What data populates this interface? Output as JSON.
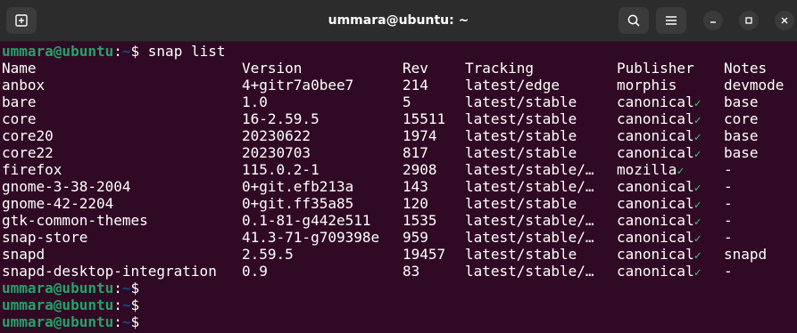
{
  "window": {
    "title": "ummara@ubuntu: ~"
  },
  "icons": {
    "new_tab": "new-tab-icon",
    "search": "search-icon",
    "menu": "hamburger-menu-icon",
    "minimize": "minimize-icon",
    "maximize": "maximize-icon",
    "close": "close-icon",
    "verified": "checkmark-icon"
  },
  "colors": {
    "background": "#300a24",
    "titlebar": "#2c2c2c",
    "prompt_user": "#26a269",
    "prompt_path": "#12488b",
    "check": "#33d17a"
  },
  "prompt": {
    "user_host": "ummara@ubuntu",
    "sep": ":",
    "path": "~",
    "symbol": "$"
  },
  "command": " snap list",
  "table": {
    "headers": [
      "Name",
      "Version",
      "Rev",
      "Tracking",
      "Publisher",
      "Notes"
    ],
    "rows": [
      {
        "name": "anbox",
        "version": "4+gitr7a0bee7",
        "rev": "214",
        "tracking": "latest/edge",
        "publisher": "morphis",
        "verified": "",
        "notes": "devmode"
      },
      {
        "name": "bare",
        "version": "1.0",
        "rev": "5",
        "tracking": "latest/stable",
        "publisher": "canonical",
        "verified": "✓",
        "notes": "base"
      },
      {
        "name": "core",
        "version": "16-2.59.5",
        "rev": "15511",
        "tracking": "latest/stable",
        "publisher": "canonical",
        "verified": "✓",
        "notes": "core"
      },
      {
        "name": "core20",
        "version": "20230622",
        "rev": "1974",
        "tracking": "latest/stable",
        "publisher": "canonical",
        "verified": "✓",
        "notes": "base"
      },
      {
        "name": "core22",
        "version": "20230703",
        "rev": "817",
        "tracking": "latest/stable",
        "publisher": "canonical",
        "verified": "✓",
        "notes": "base"
      },
      {
        "name": "firefox",
        "version": "115.0.2-1",
        "rev": "2908",
        "tracking": "latest/stable/…",
        "publisher": "mozilla",
        "verified": "✓",
        "notes": "-"
      },
      {
        "name": "gnome-3-38-2004",
        "version": "0+git.efb213a",
        "rev": "143",
        "tracking": "latest/stable/…",
        "publisher": "canonical",
        "verified": "✓",
        "notes": "-"
      },
      {
        "name": "gnome-42-2204",
        "version": "0+git.ff35a85",
        "rev": "120",
        "tracking": "latest/stable",
        "publisher": "canonical",
        "verified": "✓",
        "notes": "-"
      },
      {
        "name": "gtk-common-themes",
        "version": "0.1-81-g442e511",
        "rev": "1535",
        "tracking": "latest/stable/…",
        "publisher": "canonical",
        "verified": "✓",
        "notes": "-"
      },
      {
        "name": "snap-store",
        "version": "41.3-71-g709398e",
        "rev": "959",
        "tracking": "latest/stable/…",
        "publisher": "canonical",
        "verified": "✓",
        "notes": "-"
      },
      {
        "name": "snapd",
        "version": "2.59.5",
        "rev": "19457",
        "tracking": "latest/stable",
        "publisher": "canonical",
        "verified": "✓",
        "notes": "snapd"
      },
      {
        "name": "snapd-desktop-integration",
        "version": "0.9",
        "rev": "83",
        "tracking": "latest/stable/…",
        "publisher": "canonical",
        "verified": "✓",
        "notes": "-"
      }
    ]
  }
}
